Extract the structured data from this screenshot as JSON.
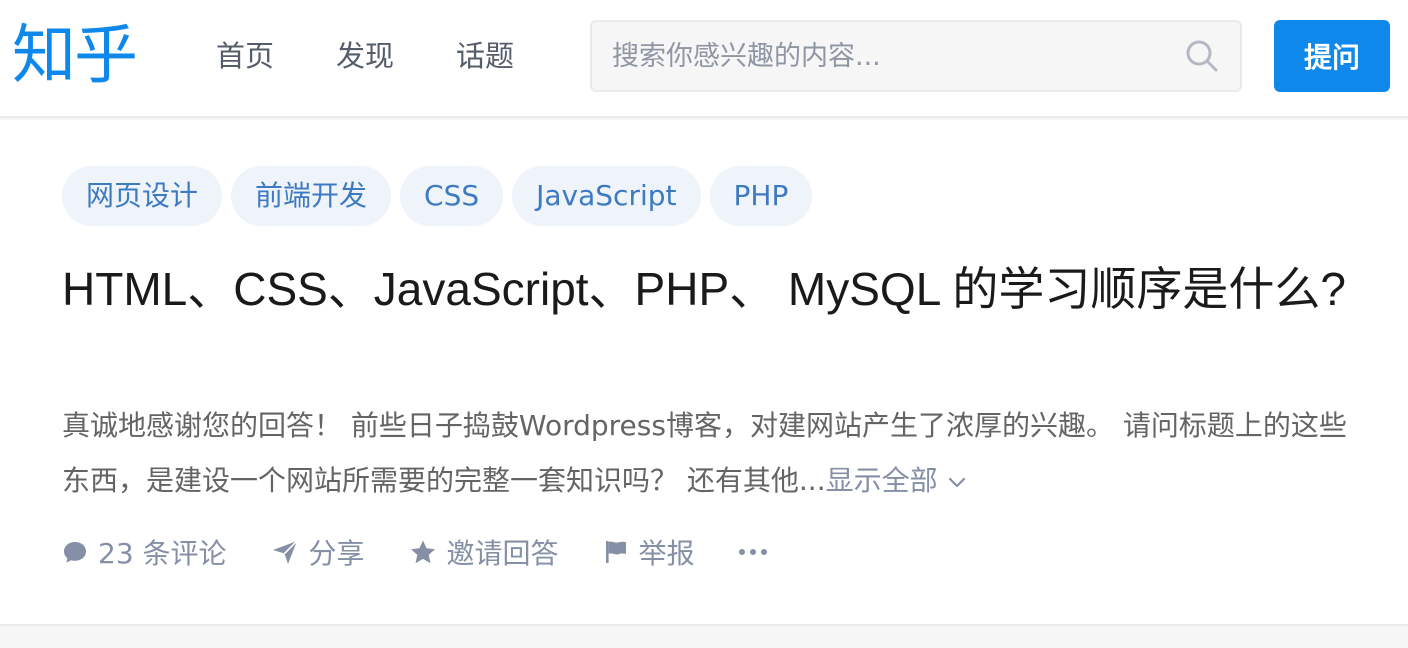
{
  "header": {
    "logo": "知乎",
    "nav": [
      "首页",
      "发现",
      "话题"
    ],
    "search_placeholder": "搜索你感兴趣的内容...",
    "ask_label": "提问"
  },
  "question": {
    "tags": [
      "网页设计",
      "前端开发",
      "CSS",
      "JavaScript",
      "PHP"
    ],
    "title": "HTML、CSS、JavaScript、PHP、 MySQL 的学习顺序是什么?",
    "detail": "真诚地感谢您的回答！ 前些日子捣鼓Wordpress博客，对建网站产生了浓厚的兴趣。 请问标题上的这些东西，是建设一个网站所需要的完整一套知识吗？ 还有其他...",
    "show_all": "显示全部",
    "actions": {
      "comments": "23 条评论",
      "share": "分享",
      "invite": "邀请回答",
      "report": "举报"
    }
  },
  "colors": {
    "brand": "#0f88eb",
    "tag_bg": "#eef4fa",
    "tag_text": "#3e7ac2",
    "muted": "#8590a6"
  }
}
